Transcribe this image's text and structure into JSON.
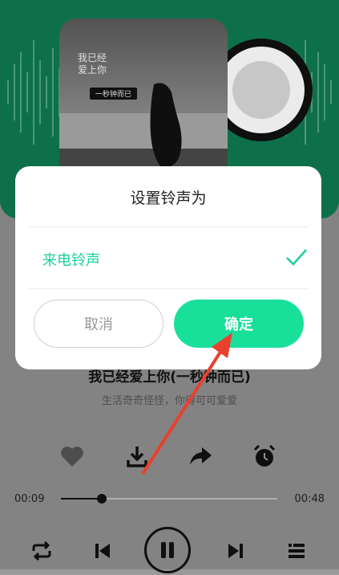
{
  "player": {
    "cover": {
      "title_text": "我已经\n爱上你",
      "tag_text": "一秒钟而已"
    },
    "song": {
      "title": "我已经爱上你(一秒钟而已)",
      "subtitle": "生活奇奇怪怪，你得可可爱爱"
    },
    "actions": [
      "heart-icon",
      "download-icon",
      "share-icon",
      "alarm-icon"
    ],
    "progress": {
      "elapsed": "00:09",
      "total": "00:48",
      "fraction": 0.1875
    },
    "controls": [
      "repeat-icon",
      "previous-icon",
      "pause-icon",
      "next-icon",
      "playlist-icon"
    ]
  },
  "dialog": {
    "title": "设置铃声为",
    "option_label": "来电铃声",
    "option_selected": true,
    "cancel_label": "取消",
    "confirm_label": "确定"
  },
  "colors": {
    "accent": "#18e09a",
    "accent_text": "#18d19a",
    "header_bg": "#0f7a52",
    "annotation_arrow": "#e8412d"
  }
}
